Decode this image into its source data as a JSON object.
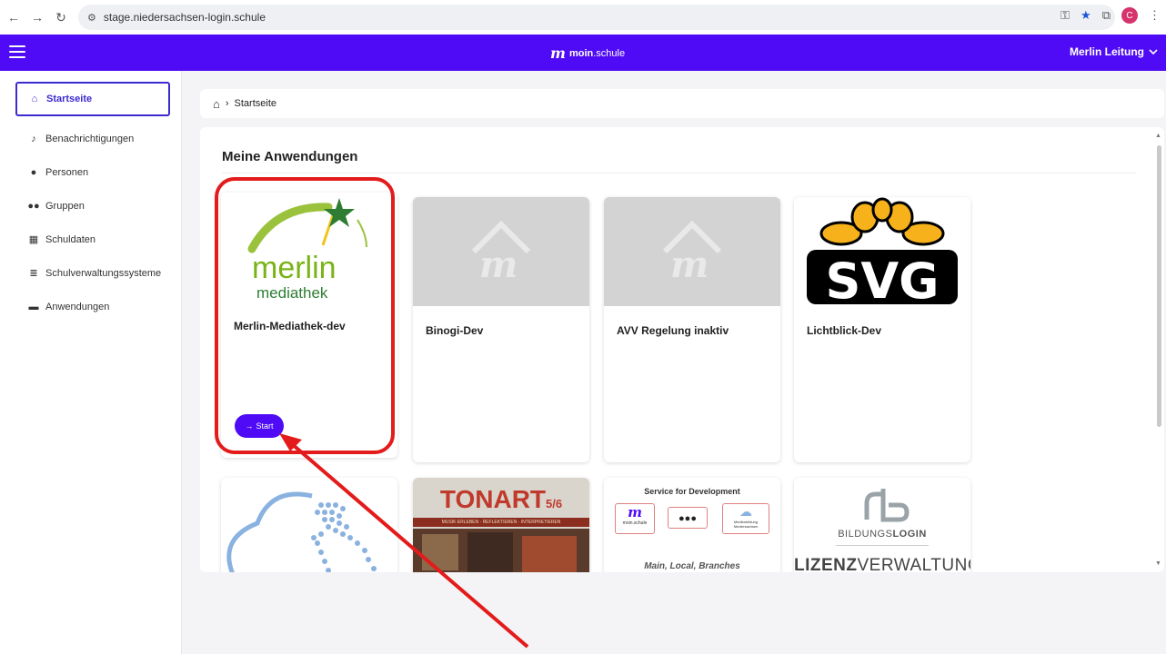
{
  "browser": {
    "url": "stage.niedersachsen-login.schule",
    "profile_initial": "C"
  },
  "header": {
    "brand_strong": "moin",
    "brand_rest": ".schule",
    "user_name": "Merlin Leitung"
  },
  "sidebar": {
    "items": [
      {
        "label": "Startseite",
        "icon": "home-icon"
      },
      {
        "label": "Benachrichtigungen",
        "icon": "bell-icon"
      },
      {
        "label": "Personen",
        "icon": "person-icon"
      },
      {
        "label": "Gruppen",
        "icon": "group-icon"
      },
      {
        "label": "Schuldaten",
        "icon": "school-icon"
      },
      {
        "label": "Schulverwaltungssysteme",
        "icon": "database-icon"
      },
      {
        "label": "Anwendungen",
        "icon": "window-icon"
      }
    ]
  },
  "breadcrumb": {
    "current": "Startseite"
  },
  "main": {
    "section_title": "Meine Anwendungen",
    "start_label": "Start",
    "apps": [
      {
        "name": "Merlin-Mediathek-dev",
        "logo_line1": "merlin",
        "logo_line2": "mediathek"
      },
      {
        "name": "Binogi-Dev"
      },
      {
        "name": "AVV Regelung inaktiv"
      },
      {
        "name": "Lichtblick-Dev",
        "logo_text": "SVG"
      }
    ],
    "row2": {
      "tonart_title": "TONART",
      "tonart_sub": "5/6",
      "tonart_tagline": "MUSIK ERLEBEN · REFLEKTIEREN · INTERPRETIEREN",
      "dev_title": "Service for Development",
      "dev_brand": "moin.schule",
      "dev_side": "Medienbildung Niedersachsen",
      "dev_footer": "Main, Local, Branches",
      "bl_title_light": "BILDUNGS",
      "bl_title_bold": "LOGIN",
      "bl_lizenz_bold": "LIZENZ",
      "bl_lizenz_light": "VERWALTUNG"
    }
  },
  "colors": {
    "brand": "#4f0bf5",
    "highlight": "#e31b1b"
  }
}
